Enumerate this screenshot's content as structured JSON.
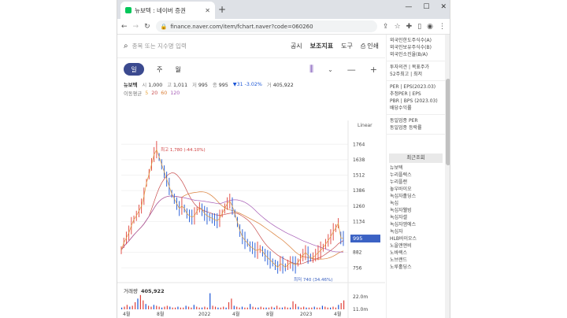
{
  "browser": {
    "tab_title": "뉴보텍 : 네이버 증권",
    "url": "finance.naver.com/item/fchart.naver?code=060260"
  },
  "search": {
    "placeholder": "종목 또는 지수명 입력"
  },
  "top_menu": [
    "공시",
    "보조지표",
    "도구",
    "인쇄"
  ],
  "periods": [
    "일",
    "주",
    "월"
  ],
  "stock": {
    "name": "뉴보텍",
    "open_label": "시",
    "open": "1,000",
    "high_label": "고",
    "high": "1,011",
    "low_label": "저",
    "low": "995",
    "close_label": "종",
    "close": "995",
    "change": "▼31 -3.02%",
    "volume_label": "거",
    "volume": "405,922"
  },
  "moving_avg": {
    "label": "이동평균",
    "periods": [
      "5",
      "20",
      "60",
      "120"
    ]
  },
  "chart_data": {
    "type": "line",
    "title": "",
    "scale": "Linear",
    "y_ticks": [
      1764,
      1638,
      1512,
      1386,
      1260,
      1134,
      882,
      756
    ],
    "ylim": [
      700,
      1830
    ],
    "x_labels": [
      "4월",
      "8월",
      "2022",
      "4월",
      "8월",
      "2023",
      "4월"
    ],
    "current_price": "995",
    "max_label": "최고 1,780 (-44.10%)",
    "min_label": "최저 740 (34.46%)",
    "price": [
      900,
      960,
      1000,
      1040,
      1100,
      1150,
      1180,
      1220,
      1260,
      1340,
      1450,
      1520,
      1600,
      1680,
      1720,
      1660,
      1600,
      1540,
      1480,
      1420,
      1360,
      1320,
      1280,
      1240,
      1260,
      1240,
      1200,
      1180,
      1170,
      1180,
      1220,
      1250,
      1230,
      1200,
      1180,
      1170,
      1160,
      1150,
      1140,
      1160,
      1200,
      1240,
      1280,
      1300,
      1260,
      1200,
      1130,
      1060,
      1010,
      980,
      960,
      930,
      920,
      900,
      900,
      910,
      890,
      860,
      840,
      820,
      800,
      780,
      760,
      790,
      780,
      760,
      780,
      800,
      790,
      780,
      800,
      830,
      860,
      880,
      860,
      840,
      840,
      860,
      880,
      900,
      920,
      950,
      980,
      1010,
      1050,
      1080,
      1120,
      1000,
      995
    ],
    "volume_label": "거래량",
    "volume": "405,922",
    "volume_ticks": [
      "22.0m",
      "11.0m"
    ],
    "volume_bars": [
      2,
      3,
      5,
      3,
      4,
      8,
      12,
      16,
      10,
      6,
      4,
      3,
      5,
      4,
      3,
      2,
      3,
      4,
      3,
      2,
      2,
      3,
      2,
      2,
      4,
      3,
      2,
      5,
      3,
      2,
      2,
      3,
      2,
      18,
      4,
      3,
      2,
      2,
      3,
      2,
      8,
      12,
      4,
      3,
      2,
      3,
      2,
      2,
      6,
      3,
      2,
      2,
      3,
      2,
      2,
      2,
      3,
      2,
      4,
      2,
      2,
      3,
      2,
      2,
      9,
      6,
      3,
      2,
      3,
      2,
      2,
      2,
      3,
      2,
      2,
      4,
      3,
      2,
      2,
      3,
      2,
      5,
      7,
      10
    ]
  },
  "sidebar": {
    "items_top": [
      "외국인한도주식수(A)",
      "외국인보유주식수(B)",
      "외국인소진율(B/A)"
    ],
    "opinion": [
      "투자의견 | 목표주가",
      "52주최고 | 최저"
    ],
    "per_rows": [
      "PER | EPS(2023.03)",
      "추정PER | EPS",
      "PBR | BPS (2023.03)",
      "배당수익률"
    ],
    "sector": [
      "동일업종 PER",
      "동일업종 등락률"
    ],
    "recent_header": "최근조회",
    "recent": [
      "뉴보텍",
      "누리플렉스",
      "누리플랜",
      "놓우바이오",
      "녹십자홀딩스",
      "녹십",
      "녹십자웰빙",
      "녹십자셀",
      "녹십자엠에스",
      "녹십자",
      "HLB바이오스",
      "노을앤앤비",
      "노바렉스",
      "노브랜드",
      "노루홀딩스"
    ]
  },
  "colors": {
    "accent": "#3b4a8f",
    "price_down": "#1a55d6",
    "price_up": "#e0413a",
    "current_price_bg": "#3b62c4"
  }
}
